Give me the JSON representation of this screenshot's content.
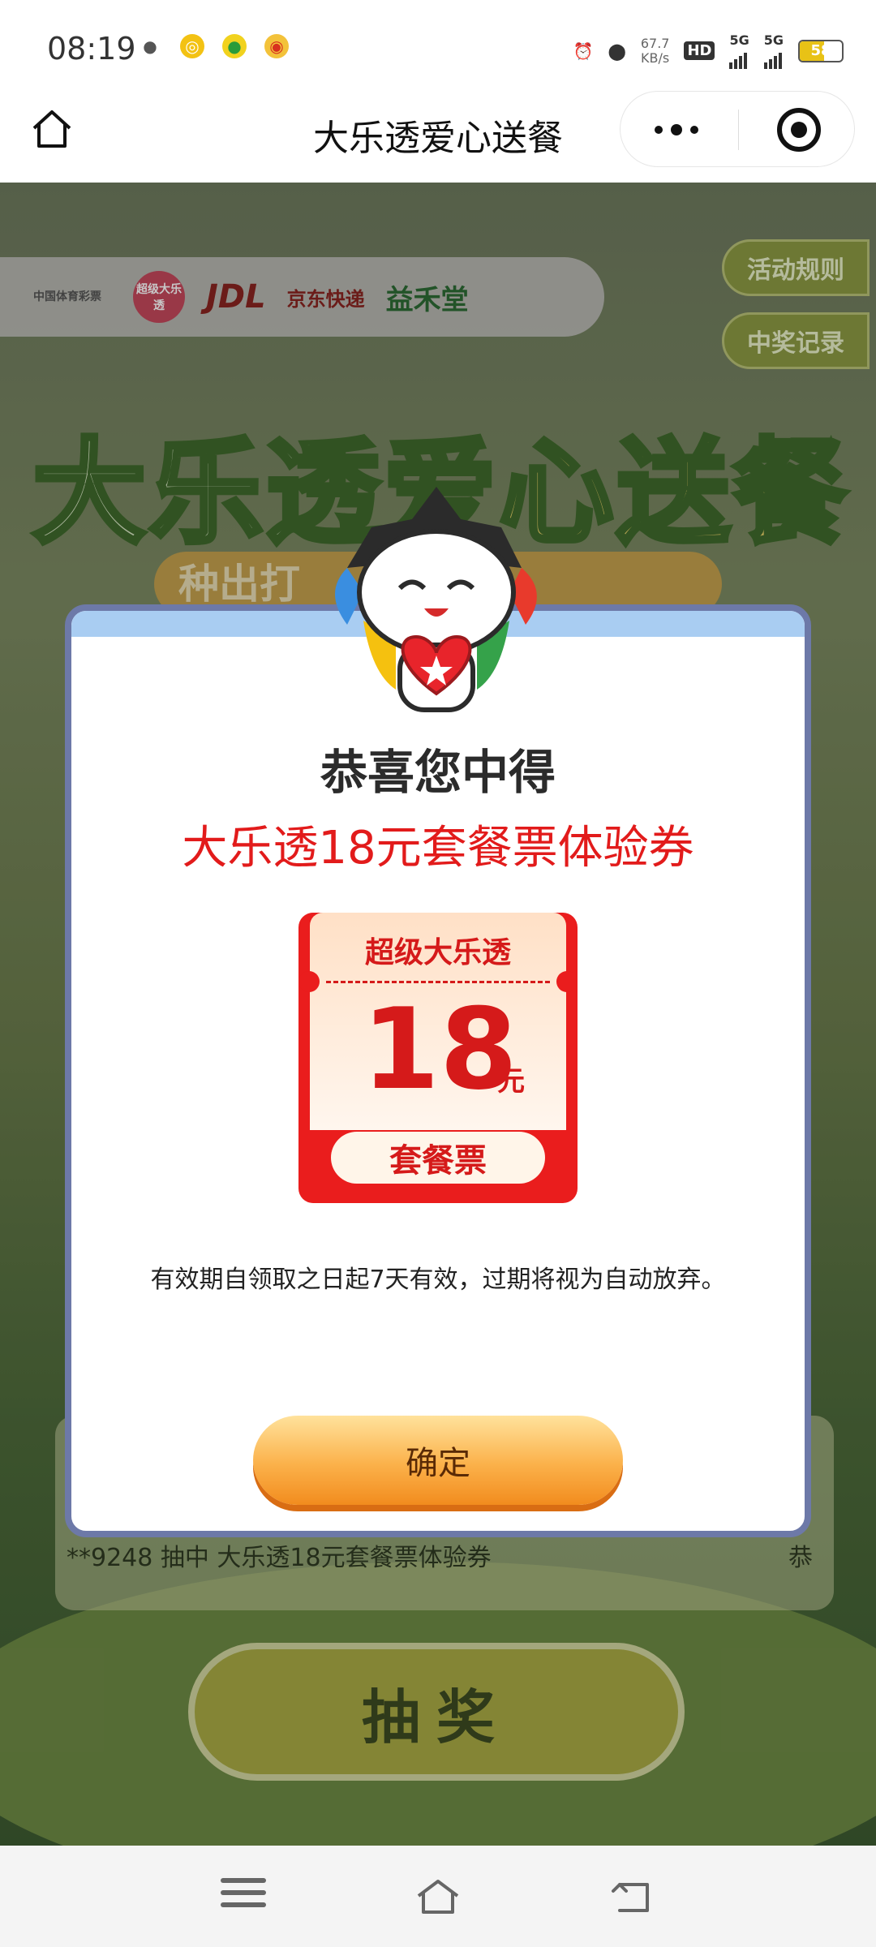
{
  "status_bar": {
    "time": "08:19",
    "net_speed_value": "67.7",
    "net_speed_unit": "KB/s",
    "hd_label": "HD",
    "sim_label": "5G",
    "sim2_label": "5G",
    "battery_level": "58"
  },
  "nav": {
    "title": "大乐透爱心送餐"
  },
  "background": {
    "sponsors": [
      "中国体育彩票",
      "超级大乐透",
      "JDL",
      "京东快递",
      "益禾堂"
    ],
    "side_buttons": [
      "活动规则",
      "中奖记录"
    ],
    "title_part1": "大乐透",
    "title_part2": "爱心送餐",
    "subtitle": "种出打",
    "marquee_left": "**9248 抽中 大乐透18元套餐票体验券",
    "marquee_right": "恭",
    "draw_button": "抽奖"
  },
  "modal": {
    "congrats": "恭喜您中得",
    "prize_name": "大乐透18元套餐票体验券",
    "ticket": {
      "header": "超级大乐透",
      "amount": "18",
      "unit": "元",
      "type_label": "套餐票"
    },
    "validity": "有效期自领取之日起7天有效，过期将视为自动放弃。",
    "confirm_label": "确定"
  },
  "colors": {
    "prize_red": "#e21b1b",
    "confirm_orange": "#f28c1e",
    "modal_border": "#6d79a8"
  }
}
